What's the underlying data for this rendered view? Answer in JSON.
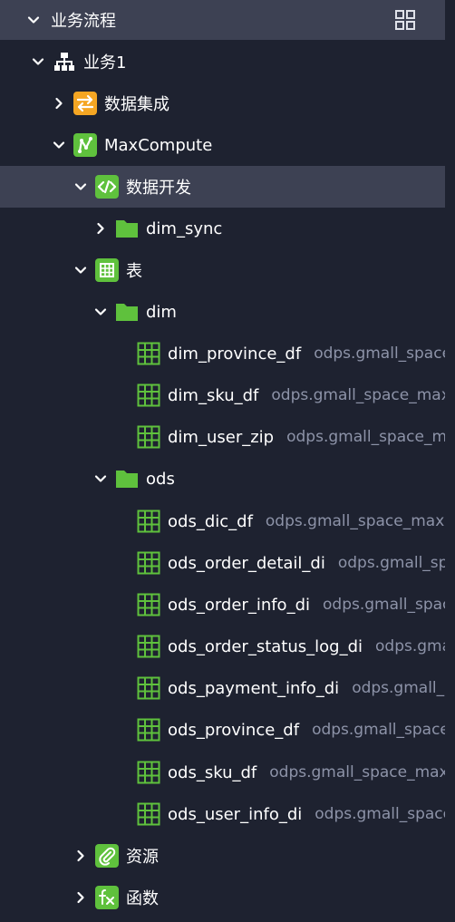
{
  "panel": {
    "title": "业务流程",
    "business": "业务1",
    "data_integration": "数据集成",
    "maxcompute": "MaxCompute",
    "data_dev": "数据开发",
    "dim_sync": "dim_sync",
    "tables": "表",
    "dim_folder": "dim",
    "ods_folder": "ods",
    "resources": "资源",
    "functions": "函数"
  },
  "dim_tables": [
    {
      "name": "dim_province_df",
      "path": "odps.gmall_space"
    },
    {
      "name": "dim_sku_df",
      "path": "odps.gmall_space_max"
    },
    {
      "name": "dim_user_zip",
      "path": "odps.gmall_space_m"
    }
  ],
  "ods_tables": [
    {
      "name": "ods_dic_df",
      "path": "odps.gmall_space_max"
    },
    {
      "name": "ods_order_detail_di",
      "path": "odps.gmall_sp"
    },
    {
      "name": "ods_order_info_di",
      "path": "odps.gmall_spac"
    },
    {
      "name": "ods_order_status_log_di",
      "path": "odps.gma"
    },
    {
      "name": "ods_payment_info_di",
      "path": "odps.gmall_s"
    },
    {
      "name": "ods_province_df",
      "path": "odps.gmall_space"
    },
    {
      "name": "ods_sku_df",
      "path": "odps.gmall_space_max"
    },
    {
      "name": "ods_user_info_di",
      "path": "odps.gmall_space"
    }
  ],
  "colors": {
    "background": "#1e2230",
    "header_bg": "#3d4153",
    "green": "#5fc13d",
    "orange": "#f5a623",
    "sub_text": "#8d93a8"
  },
  "icons": {
    "expand": "chevron-down-icon",
    "collapse": "chevron-right-icon",
    "layout": "grid-layout-icon",
    "business": "sitemap-icon",
    "integration": "swap-arrows-icon",
    "maxcompute": "maxcompute-icon",
    "code": "code-icon",
    "folder": "folder-icon",
    "table": "table-icon",
    "resource": "paperclip-icon",
    "function": "fx-icon"
  }
}
